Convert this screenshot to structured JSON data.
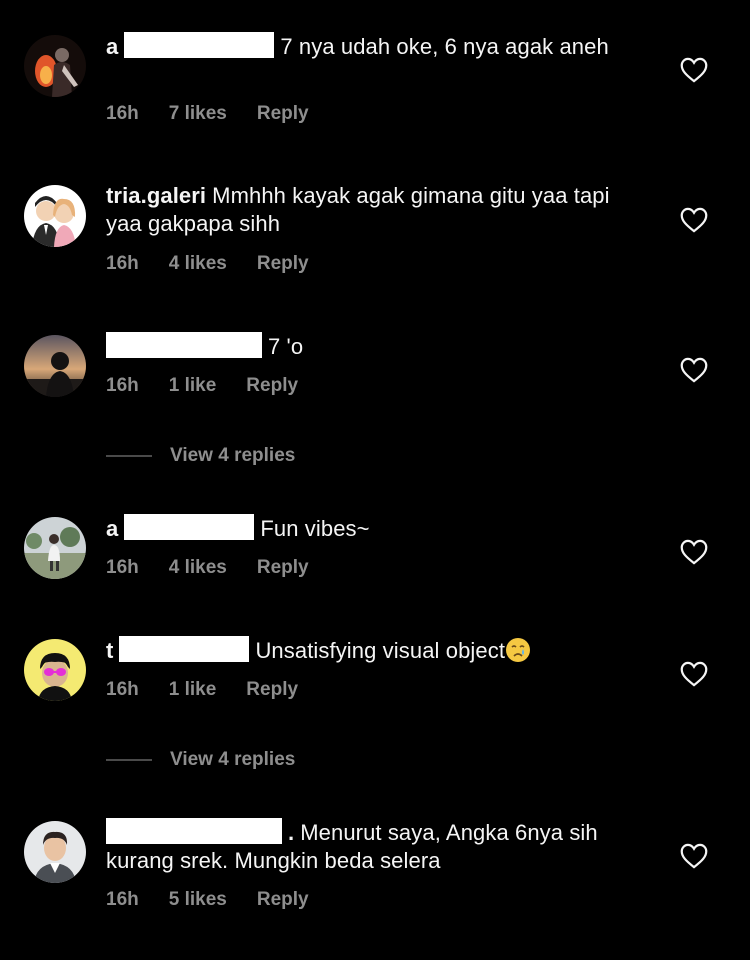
{
  "colors": {
    "background": "#000000",
    "text": "#f5f5f5",
    "meta": "#8e8e8e",
    "divider": "#4a4a4a"
  },
  "comments": [
    {
      "username_visible": "a",
      "text": "7 nya udah oke, 6 nya agak aneh",
      "time": "16h",
      "likes": "7 likes",
      "reply": "Reply",
      "avatar": "dark-figure-with-fire-avatar",
      "icon": "heart-outline-icon"
    },
    {
      "username_visible": "tria.galeri",
      "text": "Mmhhh kayak agak gimana gitu yaa tapi yaa gakpapa sihh",
      "time": "16h",
      "likes": "4 likes",
      "reply": "Reply",
      "avatar": "cartoon-couple-avatar",
      "icon": "heart-outline-icon"
    },
    {
      "username_visible": "",
      "text": "7 'o",
      "time": "16h",
      "likes": "1 like",
      "reply": "Reply",
      "avatar": "silhouette-sunset-avatar",
      "icon": "heart-outline-icon"
    },
    {
      "username_visible": "a",
      "text": "Fun vibes~",
      "time": "16h",
      "likes": "4 likes",
      "reply": "Reply",
      "avatar": "outdoor-person-avatar",
      "icon": "heart-outline-icon"
    },
    {
      "username_visible": "t",
      "text": "Unsatisfying visual object",
      "time": "16h",
      "likes": "1 like",
      "reply": "Reply",
      "avatar": "yellow-cartoon-glasses-avatar",
      "icon": "heart-outline-icon",
      "emoji": "crying-face-emoji"
    },
    {
      "username_visible": ".",
      "text": "Menurut saya, Angka 6nya sih kurang srek. Mungkin beda selera",
      "time": "16h",
      "likes": "5 likes",
      "reply": "Reply",
      "avatar": "man-portrait-avatar",
      "icon": "heart-outline-icon"
    }
  ],
  "view_replies": [
    {
      "label": "View 4 replies"
    },
    {
      "label": "View 4 replies"
    }
  ]
}
